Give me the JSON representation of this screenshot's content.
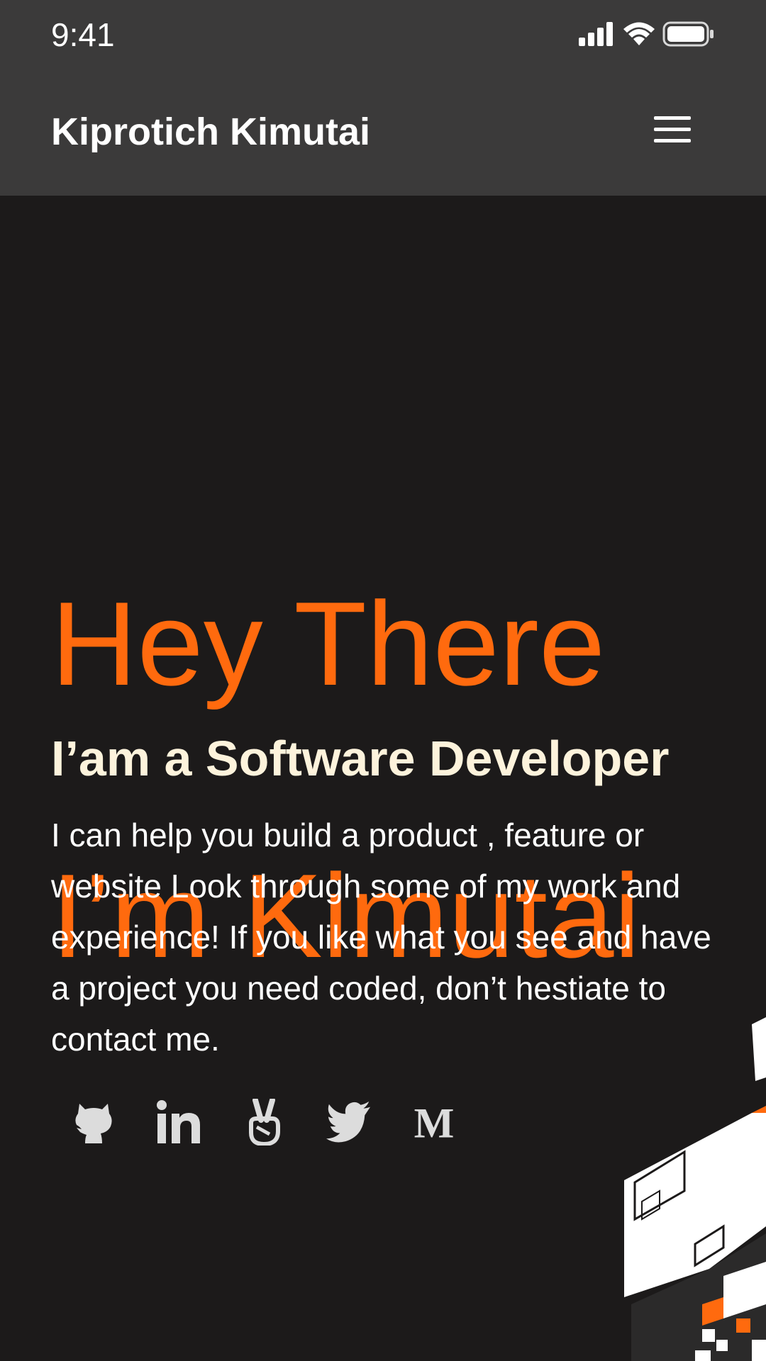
{
  "status_bar": {
    "time": "9:41"
  },
  "header": {
    "brand": "Kiprotich Kimutai",
    "menu_icon": "hamburger-menu-icon"
  },
  "hero": {
    "title_line1": "Hey There",
    "title_line2": "I’m Kimutai",
    "subtitle": "I’am a Software Developer",
    "intro": "I can help you build a product , feature or website Look through some of my work and experience! If you like what you see and have a project you need coded, don’t hestiate to contact me."
  },
  "social_links": [
    {
      "icon": "github-icon"
    },
    {
      "icon": "linkedin-icon"
    },
    {
      "icon": "angellist-icon"
    },
    {
      "icon": "twitter-icon"
    },
    {
      "icon": "medium-icon",
      "glyph": "M"
    }
  ],
  "colors": {
    "accent": "#ff6a0e",
    "background": "#1c1a1a",
    "header": "#3b3a3a",
    "subtitle": "#fdf3dc",
    "icon": "#dcdcdc"
  }
}
